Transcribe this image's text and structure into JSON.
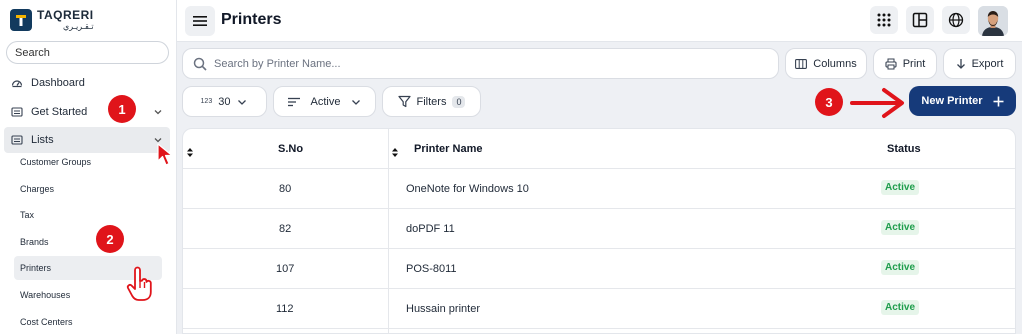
{
  "brand": {
    "name_en": "TAQRERI",
    "name_ar": "تـقـريـري",
    "color": "#123a5e"
  },
  "sidebar": {
    "search_placeholder": "Search",
    "dashboard": "Dashboard",
    "get_started": "Get Started",
    "lists": "Lists",
    "sub_items": [
      "Customer Groups",
      "Charges",
      "Tax",
      "Brands",
      "Printers",
      "Warehouses",
      "Cost Centers"
    ],
    "active_sub_item": "Printers"
  },
  "header": {
    "title": "Printers"
  },
  "toolbar": {
    "search_placeholder": "Search by Printer Name...",
    "columns_label": "Columns",
    "print_label": "Print",
    "export_label": "Export",
    "page_size_prefix": "123",
    "page_size": "30",
    "status_filter": "Active",
    "filters_label": "Filters",
    "filters_count": "0",
    "new_button_label": "New Printer",
    "accent_color": "#163a7a"
  },
  "table": {
    "columns": [
      "S.No",
      "Printer Name",
      "Status"
    ],
    "rows": [
      {
        "sno": "80",
        "name": "OneNote for Windows 10",
        "status": "Active"
      },
      {
        "sno": "82",
        "name": "doPDF 11",
        "status": "Active"
      },
      {
        "sno": "107",
        "name": "POS-8011",
        "status": "Active"
      },
      {
        "sno": "112",
        "name": "Hussain printer",
        "status": "Active"
      }
    ],
    "status_color": "#1f9d4c"
  },
  "annotations": {
    "steps": [
      "1",
      "2",
      "3"
    ],
    "color": "#e0141a"
  }
}
